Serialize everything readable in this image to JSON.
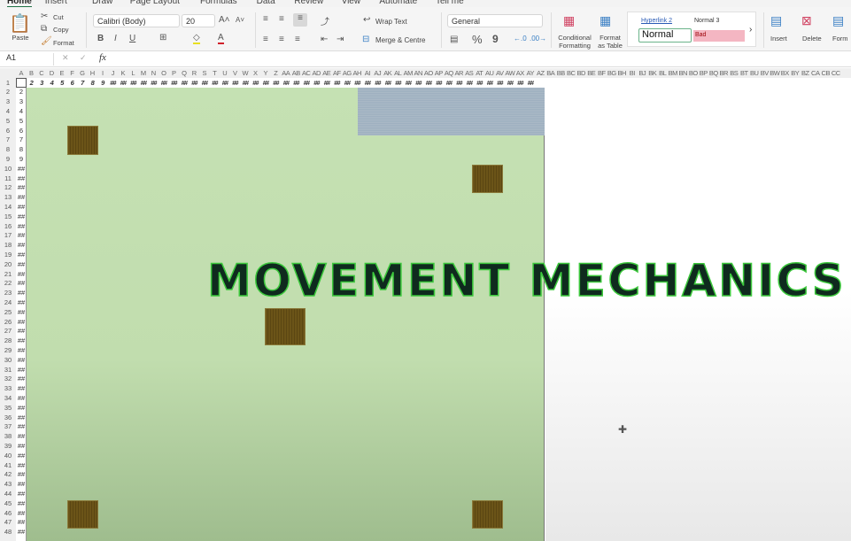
{
  "ribbon_tabs": [
    "Home",
    "Insert",
    "Draw",
    "Page Layout",
    "Formulas",
    "Data",
    "Review",
    "View",
    "Automate",
    "Tell me"
  ],
  "clipboard": {
    "paste": "Paste",
    "cut": "Cut",
    "copy": "Copy",
    "format": "Format"
  },
  "font": {
    "name": "Calibri (Body)",
    "size": "20",
    "bold": "B",
    "italic": "I",
    "underline": "U"
  },
  "alignment": {
    "wrap_text": "Wrap Text",
    "merge": "Merge & Centre"
  },
  "number": {
    "format": "General",
    "percent": "%",
    "comma": "9"
  },
  "styles": {
    "conditional": [
      "Conditional",
      "Formatting"
    ],
    "format_table": [
      "Format",
      "as Table"
    ],
    "hyperlink2": "Hyperlink 2",
    "normal3": "Normal 3",
    "normal": "Normal",
    "bad": "Bad",
    "more": "›"
  },
  "cells": {
    "insert": "Insert",
    "delete": "Delete",
    "format": "Form"
  },
  "formula_bar": {
    "name_box": "A1",
    "fx": "fx",
    "cancel": "✕",
    "enter": "✓"
  },
  "columns": [
    "A",
    "B",
    "C",
    "D",
    "E",
    "F",
    "G",
    "H",
    "I",
    "J",
    "K",
    "L",
    "M",
    "N",
    "O",
    "P",
    "Q",
    "R",
    "S",
    "T",
    "U",
    "V",
    "W",
    "X",
    "Y",
    "Z",
    "AA",
    "AB",
    "AC",
    "AD",
    "AE",
    "AF",
    "AG",
    "AH",
    "AI",
    "AJ",
    "AK",
    "AL",
    "AM",
    "AN",
    "AO",
    "AP",
    "AQ",
    "AR",
    "AS",
    "AT",
    "AU",
    "AV",
    "AW",
    "AX",
    "AY",
    "AZ",
    "BA",
    "BB",
    "BC",
    "BD",
    "BE",
    "BF",
    "BG",
    "BH",
    "BI",
    "BJ",
    "BK",
    "BL",
    "BM",
    "BN",
    "BO",
    "BP",
    "BQ",
    "BR",
    "BS",
    "BT",
    "BU",
    "BV",
    "BW",
    "BX",
    "BY",
    "BZ",
    "CA",
    "CB",
    "CC"
  ],
  "row1_values": [
    "",
    "2",
    "3",
    "4",
    "5",
    "6",
    "7",
    "8",
    "9",
    "##",
    "##",
    "##",
    "##",
    "##",
    "##",
    "##",
    "##",
    "##",
    "##",
    "##",
    "##",
    "##",
    "##",
    "##",
    "##",
    "##",
    "##",
    "##",
    "##",
    "##",
    "##",
    "##",
    "##",
    "##",
    "##",
    "##",
    "##",
    "##",
    "##",
    "##",
    "##",
    "##",
    "##",
    "##",
    "##",
    "##",
    "##",
    "##",
    "##",
    "##",
    "##"
  ],
  "row_count": 48,
  "colA_values": [
    "",
    "2",
    "3",
    "4",
    "5",
    "6",
    "7",
    "8",
    "9",
    "##"
  ],
  "overlay_title": "MOVEMENT MECHANICS",
  "colors": {
    "canvas_green": "#c5e1b3",
    "block_brown": "#6b5418",
    "stripe_blue": "#a4b4c3",
    "title_fill": "#0f2a1e",
    "title_outline": "#3cc83c",
    "bad_style": "#f4b6c2"
  }
}
